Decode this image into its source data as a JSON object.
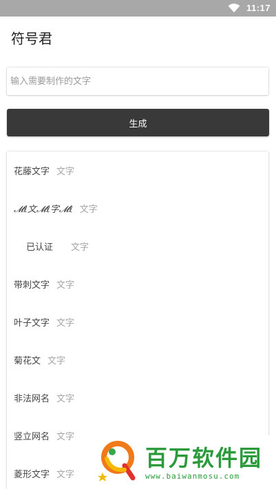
{
  "status_bar": {
    "time": "11:17",
    "wifi_icon": "wifi-icon"
  },
  "header": {
    "title": "符号君"
  },
  "input": {
    "placeholder": "输入需要制作的文字",
    "value": ""
  },
  "generate_button": {
    "label": "生成"
  },
  "styles_list": [
    {
      "name": "花藤文字",
      "sample": "文字"
    },
    {
      "name": "𝓜ℓ文𝓜ℓ字𝓜ℓ",
      "sample": "文字"
    },
    {
      "name": "已认证",
      "sample": "文字"
    },
    {
      "name": "带刺文字",
      "sample": "文字"
    },
    {
      "name": "叶子文字",
      "sample": "文字"
    },
    {
      "name": "菊花文",
      "sample": "文字"
    },
    {
      "name": "非法网名",
      "sample": "文字"
    },
    {
      "name": "竖立网名",
      "sample": "文字"
    },
    {
      "name": "菱形文字",
      "sample": "文字"
    }
  ],
  "watermark": {
    "brand": "百万软件园",
    "url": "www.baiwanmosu.com",
    "logo_icon": "baiwan-logo-icon"
  },
  "colors": {
    "status_bar": "#a8a8a8",
    "button": "#393939",
    "accent_green": "#2a9a3a"
  }
}
